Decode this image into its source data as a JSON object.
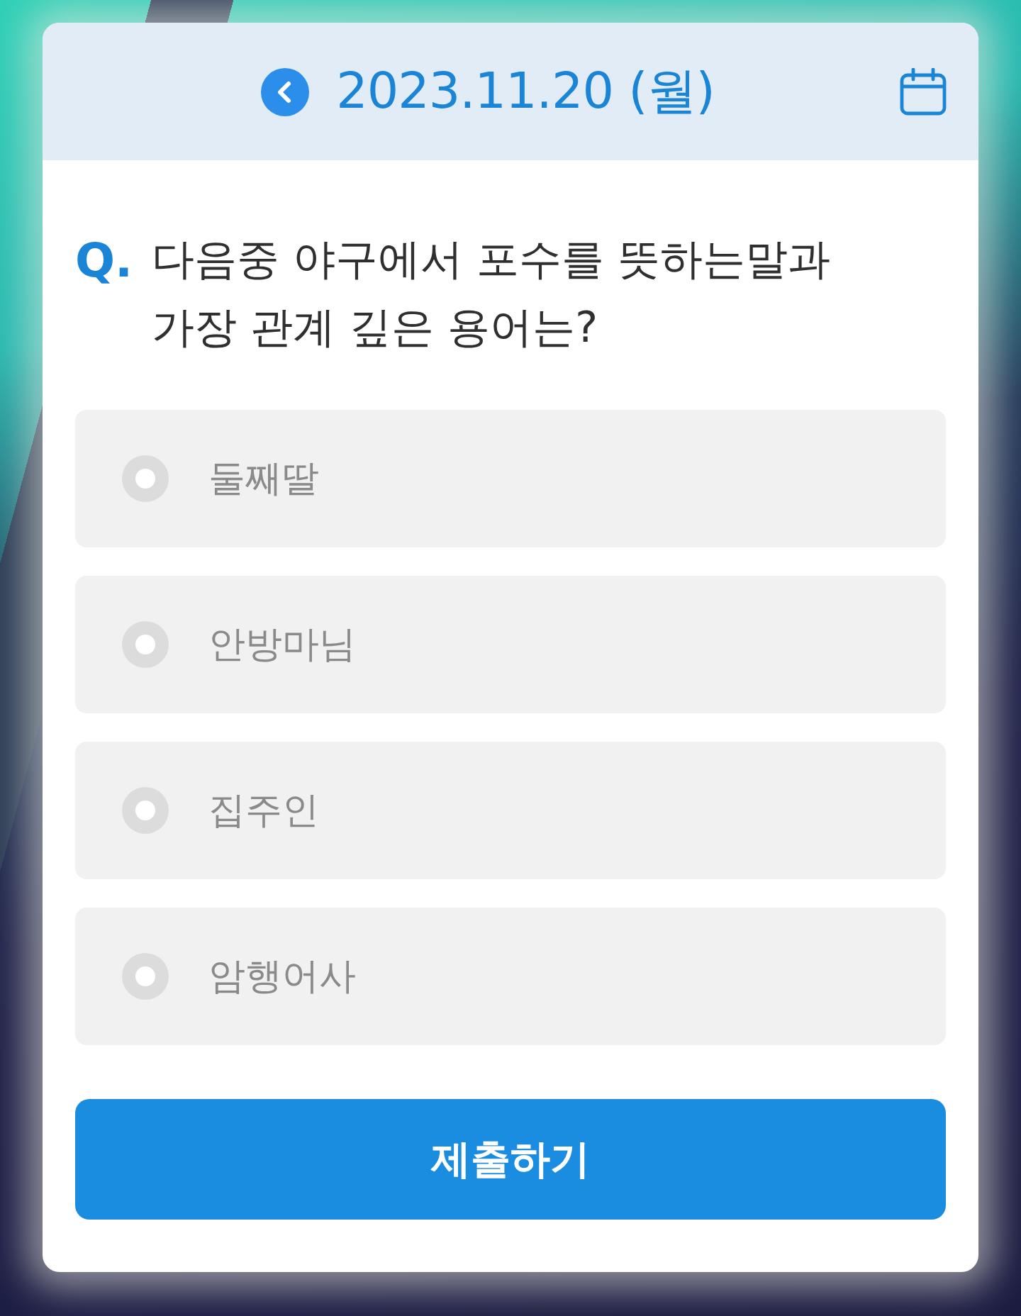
{
  "header": {
    "date": "2023.11.20 (월)"
  },
  "question": {
    "marker": "Q.",
    "text": "다음중 야구에서 포수를 뜻하는말과 가장 관계 깊은 용어는?"
  },
  "options": [
    {
      "label": "둘째딸",
      "selected": false
    },
    {
      "label": "안방마님",
      "selected": false
    },
    {
      "label": "집주인",
      "selected": false
    },
    {
      "label": "암행어사",
      "selected": false
    }
  ],
  "submit_button": {
    "label": "제출하기"
  }
}
